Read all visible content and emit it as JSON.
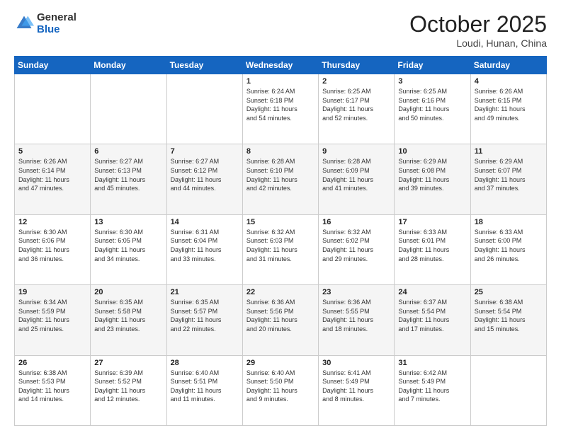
{
  "header": {
    "logo_general": "General",
    "logo_blue": "Blue",
    "month_title": "October 2025",
    "location": "Loudi, Hunan, China"
  },
  "weekdays": [
    "Sunday",
    "Monday",
    "Tuesday",
    "Wednesday",
    "Thursday",
    "Friday",
    "Saturday"
  ],
  "weeks": [
    [
      {
        "day": "",
        "text": ""
      },
      {
        "day": "",
        "text": ""
      },
      {
        "day": "",
        "text": ""
      },
      {
        "day": "1",
        "text": "Sunrise: 6:24 AM\nSunset: 6:18 PM\nDaylight: 11 hours\nand 54 minutes."
      },
      {
        "day": "2",
        "text": "Sunrise: 6:25 AM\nSunset: 6:17 PM\nDaylight: 11 hours\nand 52 minutes."
      },
      {
        "day": "3",
        "text": "Sunrise: 6:25 AM\nSunset: 6:16 PM\nDaylight: 11 hours\nand 50 minutes."
      },
      {
        "day": "4",
        "text": "Sunrise: 6:26 AM\nSunset: 6:15 PM\nDaylight: 11 hours\nand 49 minutes."
      }
    ],
    [
      {
        "day": "5",
        "text": "Sunrise: 6:26 AM\nSunset: 6:14 PM\nDaylight: 11 hours\nand 47 minutes."
      },
      {
        "day": "6",
        "text": "Sunrise: 6:27 AM\nSunset: 6:13 PM\nDaylight: 11 hours\nand 45 minutes."
      },
      {
        "day": "7",
        "text": "Sunrise: 6:27 AM\nSunset: 6:12 PM\nDaylight: 11 hours\nand 44 minutes."
      },
      {
        "day": "8",
        "text": "Sunrise: 6:28 AM\nSunset: 6:10 PM\nDaylight: 11 hours\nand 42 minutes."
      },
      {
        "day": "9",
        "text": "Sunrise: 6:28 AM\nSunset: 6:09 PM\nDaylight: 11 hours\nand 41 minutes."
      },
      {
        "day": "10",
        "text": "Sunrise: 6:29 AM\nSunset: 6:08 PM\nDaylight: 11 hours\nand 39 minutes."
      },
      {
        "day": "11",
        "text": "Sunrise: 6:29 AM\nSunset: 6:07 PM\nDaylight: 11 hours\nand 37 minutes."
      }
    ],
    [
      {
        "day": "12",
        "text": "Sunrise: 6:30 AM\nSunset: 6:06 PM\nDaylight: 11 hours\nand 36 minutes."
      },
      {
        "day": "13",
        "text": "Sunrise: 6:30 AM\nSunset: 6:05 PM\nDaylight: 11 hours\nand 34 minutes."
      },
      {
        "day": "14",
        "text": "Sunrise: 6:31 AM\nSunset: 6:04 PM\nDaylight: 11 hours\nand 33 minutes."
      },
      {
        "day": "15",
        "text": "Sunrise: 6:32 AM\nSunset: 6:03 PM\nDaylight: 11 hours\nand 31 minutes."
      },
      {
        "day": "16",
        "text": "Sunrise: 6:32 AM\nSunset: 6:02 PM\nDaylight: 11 hours\nand 29 minutes."
      },
      {
        "day": "17",
        "text": "Sunrise: 6:33 AM\nSunset: 6:01 PM\nDaylight: 11 hours\nand 28 minutes."
      },
      {
        "day": "18",
        "text": "Sunrise: 6:33 AM\nSunset: 6:00 PM\nDaylight: 11 hours\nand 26 minutes."
      }
    ],
    [
      {
        "day": "19",
        "text": "Sunrise: 6:34 AM\nSunset: 5:59 PM\nDaylight: 11 hours\nand 25 minutes."
      },
      {
        "day": "20",
        "text": "Sunrise: 6:35 AM\nSunset: 5:58 PM\nDaylight: 11 hours\nand 23 minutes."
      },
      {
        "day": "21",
        "text": "Sunrise: 6:35 AM\nSunset: 5:57 PM\nDaylight: 11 hours\nand 22 minutes."
      },
      {
        "day": "22",
        "text": "Sunrise: 6:36 AM\nSunset: 5:56 PM\nDaylight: 11 hours\nand 20 minutes."
      },
      {
        "day": "23",
        "text": "Sunrise: 6:36 AM\nSunset: 5:55 PM\nDaylight: 11 hours\nand 18 minutes."
      },
      {
        "day": "24",
        "text": "Sunrise: 6:37 AM\nSunset: 5:54 PM\nDaylight: 11 hours\nand 17 minutes."
      },
      {
        "day": "25",
        "text": "Sunrise: 6:38 AM\nSunset: 5:54 PM\nDaylight: 11 hours\nand 15 minutes."
      }
    ],
    [
      {
        "day": "26",
        "text": "Sunrise: 6:38 AM\nSunset: 5:53 PM\nDaylight: 11 hours\nand 14 minutes."
      },
      {
        "day": "27",
        "text": "Sunrise: 6:39 AM\nSunset: 5:52 PM\nDaylight: 11 hours\nand 12 minutes."
      },
      {
        "day": "28",
        "text": "Sunrise: 6:40 AM\nSunset: 5:51 PM\nDaylight: 11 hours\nand 11 minutes."
      },
      {
        "day": "29",
        "text": "Sunrise: 6:40 AM\nSunset: 5:50 PM\nDaylight: 11 hours\nand 9 minutes."
      },
      {
        "day": "30",
        "text": "Sunrise: 6:41 AM\nSunset: 5:49 PM\nDaylight: 11 hours\nand 8 minutes."
      },
      {
        "day": "31",
        "text": "Sunrise: 6:42 AM\nSunset: 5:49 PM\nDaylight: 11 hours\nand 7 minutes."
      },
      {
        "day": "",
        "text": ""
      }
    ]
  ]
}
